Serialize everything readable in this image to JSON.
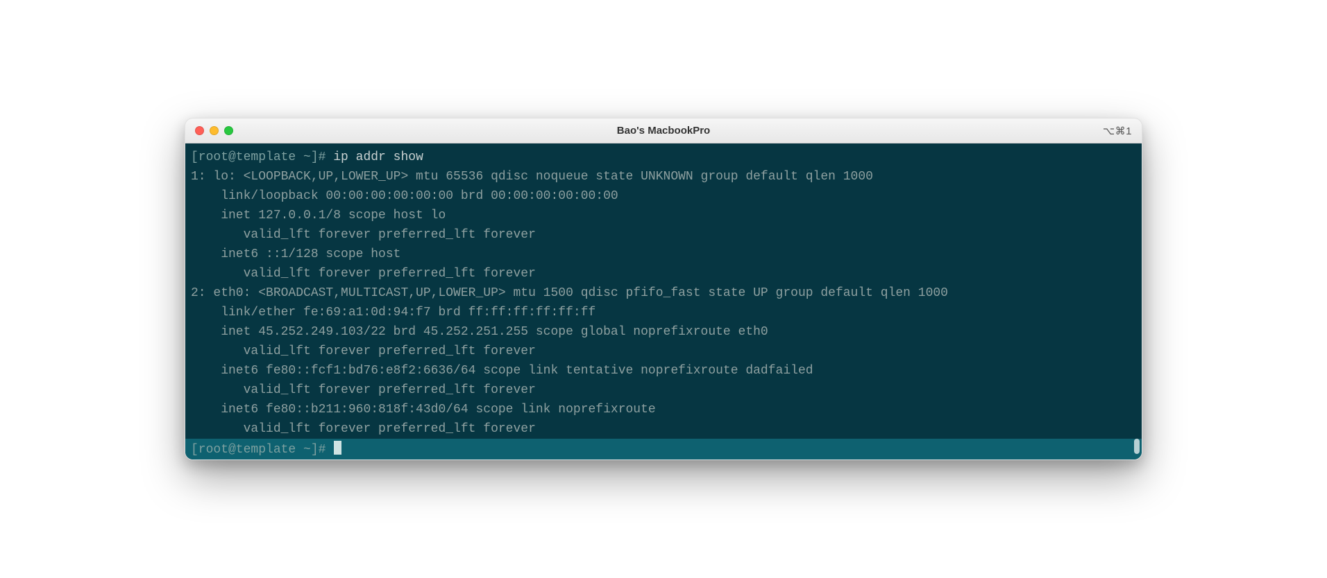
{
  "window": {
    "title": "Bao's MacbookPro",
    "shortcut": "⌥⌘1"
  },
  "terminal": {
    "prompt": "[root@template ~]#",
    "command": "ip addr show",
    "output": [
      "1: lo: <LOOPBACK,UP,LOWER_UP> mtu 65536 qdisc noqueue state UNKNOWN group default qlen 1000",
      "    link/loopback 00:00:00:00:00:00 brd 00:00:00:00:00:00",
      "    inet 127.0.0.1/8 scope host lo",
      "       valid_lft forever preferred_lft forever",
      "    inet6 ::1/128 scope host",
      "       valid_lft forever preferred_lft forever",
      "2: eth0: <BROADCAST,MULTICAST,UP,LOWER_UP> mtu 1500 qdisc pfifo_fast state UP group default qlen 1000",
      "    link/ether fe:69:a1:0d:94:f7 brd ff:ff:ff:ff:ff:ff",
      "    inet 45.252.249.103/22 brd 45.252.251.255 scope global noprefixroute eth0",
      "       valid_lft forever preferred_lft forever",
      "    inet6 fe80::fcf1:bd76:e8f2:6636/64 scope link tentative noprefixroute dadfailed",
      "       valid_lft forever preferred_lft forever",
      "    inet6 fe80::b211:960:818f:43d0/64 scope link noprefixroute",
      "       valid_lft forever preferred_lft forever"
    ]
  }
}
